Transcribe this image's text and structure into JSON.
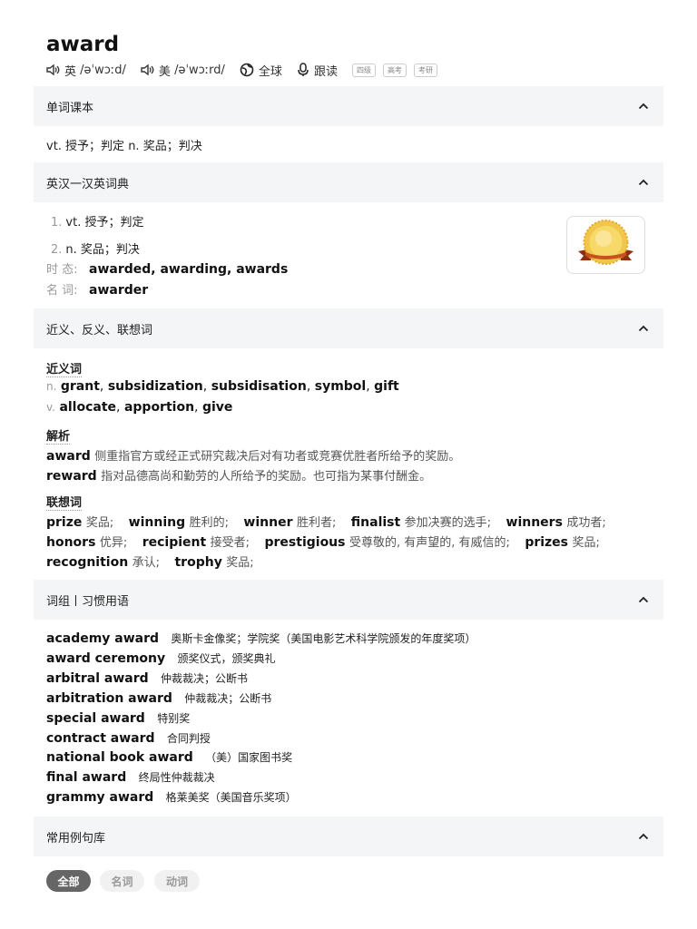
{
  "word": "award",
  "pron": {
    "uk_label": "英",
    "uk_ipa": "/əˈwɔːd/",
    "us_label": "美",
    "us_ipa": "/əˈwɔːrd/",
    "global": "全球",
    "follow": "跟读",
    "tags": [
      "四级",
      "高考",
      "考研"
    ]
  },
  "sections": {
    "course": "单词课本",
    "dict": "英汉一汉英词典",
    "syn": "近义、反义、联想词",
    "phrase": "词组丨习惯用语",
    "examples": "常用例句库"
  },
  "course_def": "vt. 授予；判定 n. 奖品；判决",
  "dict": {
    "defs": [
      {
        "num": "1.",
        "text": "vt. 授予；判定"
      },
      {
        "num": "2.",
        "text": "n. 奖品；判决"
      }
    ],
    "tense_label": "时 态:",
    "tense_value": "awarded, awarding, awards",
    "noun_label": "名 词:",
    "noun_value": "awarder"
  },
  "syn": {
    "title": "近义词",
    "n_pos": "n.",
    "n_words": [
      "grant",
      "subsidization",
      "subsidisation",
      "symbol",
      "gift"
    ],
    "v_pos": "v.",
    "v_words": [
      "allocate",
      "apportion",
      "give"
    ],
    "analysis_title": "解析",
    "analysis": [
      {
        "word": "award",
        "text": "侧重指官方或经正式研究裁决后对有功者或竞赛优胜者所给予的奖励。"
      },
      {
        "word": "reward",
        "text": "指对品德高尚和勤劳的人所给予的奖励。也可指为某事付酬金。"
      }
    ],
    "assoc_title": "联想词",
    "assoc_rows": [
      [
        {
          "w": "prize",
          "m": "奖品;"
        },
        {
          "w": "winning",
          "m": "胜利的;"
        },
        {
          "w": "winner",
          "m": "胜利者;"
        },
        {
          "w": "finalist",
          "m": "参加决赛的选手;"
        },
        {
          "w": "winners",
          "m": "成功者;"
        }
      ],
      [
        {
          "w": "honors",
          "m": "优异;"
        },
        {
          "w": "recipient",
          "m": "接受者;"
        },
        {
          "w": "prestigious",
          "m": "受尊敬的, 有声望的, 有威信的;"
        },
        {
          "w": "prizes",
          "m": "奖品;"
        }
      ],
      [
        {
          "w": "recognition",
          "m": "承认;"
        },
        {
          "w": "trophy",
          "m": "奖品;"
        }
      ]
    ]
  },
  "phrases": [
    {
      "en": "academy award",
      "cn": "奥斯卡金像奖；学院奖（美国电影艺术科学院颁发的年度奖项）"
    },
    {
      "en": "award ceremony",
      "cn": "颁奖仪式，颁奖典礼"
    },
    {
      "en": "arbitral award",
      "cn": "仲裁裁决；公断书"
    },
    {
      "en": "arbitration award",
      "cn": "仲裁裁决；公断书"
    },
    {
      "en": "special award",
      "cn": "特别奖"
    },
    {
      "en": "contract award",
      "cn": "合同判授"
    },
    {
      "en": "national book award",
      "cn": "（美）国家图书奖"
    },
    {
      "en": "final award",
      "cn": "终局性仲裁裁决"
    },
    {
      "en": "grammy award",
      "cn": "格莱美奖（美国音乐奖项）"
    }
  ],
  "filters": {
    "all": "全部",
    "noun": "名词",
    "verb": "动词"
  },
  "colors": {
    "section_bg": "#f4f5f6",
    "active_pill": "#666666",
    "inactive_pill": "#f1f1f1"
  }
}
